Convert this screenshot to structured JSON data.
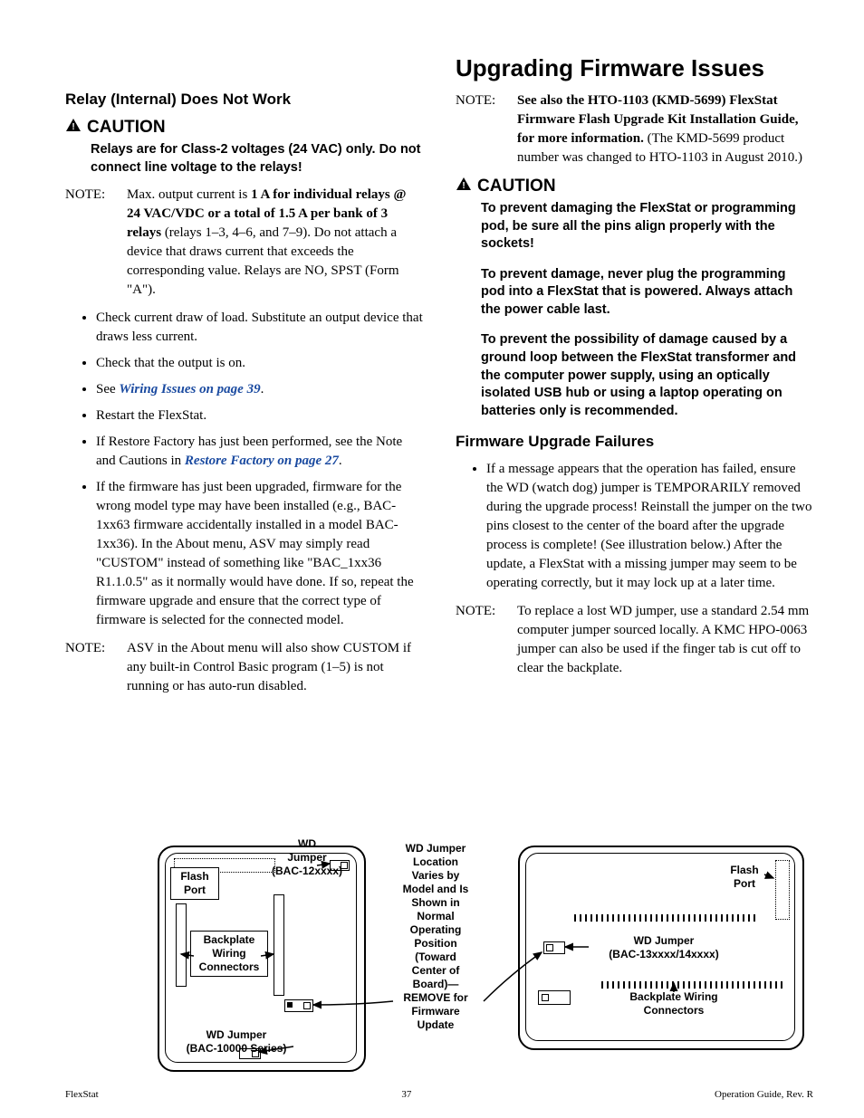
{
  "left": {
    "heading_relay": "Relay (Internal) Does Not Work",
    "caution_label": "CAUTION",
    "caution_body": "Relays are for Class-2 voltages (24 VAC) only. Do not connect line voltage to the relays!",
    "note1_label": "NOTE:",
    "note1_pre": "Max. output current is ",
    "note1_bold": "1 A for individual relays @ 24 VAC/VDC or a total of 1.5 A per bank of 3 relays",
    "note1_post": " (relays 1–3, 4–6, and 7–9). Do not attach a device that draws current that exceeds the corresponding value. Relays are NO, SPST (Form \"A\").",
    "bullets": {
      "b1": "Check current draw of load. Substitute an output device that draws less current.",
      "b2": "Check that the output is on.",
      "b3_pre": "See ",
      "b3_link": "Wiring Issues on page 39",
      "b3_post": ".",
      "b4": "Restart the FlexStat.",
      "b5_pre": "If Restore Factory has just been performed, see the Note and Cautions in ",
      "b5_link": "Restore Factory on page 27",
      "b5_post": ".",
      "b6": "If the firmware has just been upgraded, firmware for the wrong model type may have been installed (e.g., BAC-1xx63 firmware accidentally installed in a model BAC-1xx36). In the About menu, ASV may simply read \"CUSTOM\" instead of something like \"BAC_1xx36 R1.1.0.5\" as it normally would have done. If so, repeat the firmware upgrade and ensure that the correct type of firmware is selected for the connected model."
    },
    "note2_label": "NOTE:",
    "note2_body": "ASV in the About menu will also show CUSTOM if any built-in Control Basic program (1–5) is not running or has auto-run disabled."
  },
  "right": {
    "heading_firmware": "Upgrading Firmware Issues",
    "note1_label": "NOTE:",
    "note1_bold": "See also the HTO-1103 (KMD-5699) FlexStat Firmware Flash Upgrade Kit Installation Guide, for more information.",
    "note1_rest": " (The KMD-5699 product number was changed to HTO-1103 in August 2010.)",
    "caution_label": "CAUTION",
    "caution_p1": "To prevent damaging the FlexStat or programming pod, be sure all the pins align properly with the sockets!",
    "caution_p2": "To prevent damage, never plug the programming pod into a FlexStat that is powered. Always attach the power cable last.",
    "caution_p3": "To prevent the possibility of damage caused by a ground loop between the FlexStat transformer and the computer power supply, using an optically isolated USB hub or using a laptop operating on batteries only is recommended.",
    "heading_failures": "Firmware Upgrade Failures",
    "fail_b1_pre": "If a message appears that the operation has failed, ",
    "fail_b1_bold": "ensure the WD (watch dog) jumper is TEMPORARILY removed during the upgrade process! Reinstall the jumper on the two pins closest to the center of the board after the upgrade process is complete!",
    "fail_b1_post": " (See illustration below.) After the update, a FlexStat with a missing jumper may seem to be operating correctly, but it may lock up at a later time.",
    "note2_label": "NOTE:",
    "note2_body": "To replace a lost WD jumper, use a standard 2.54 mm computer jumper sourced locally. A KMC HPO-0063 jumper can also be used if the finger tab is cut off to clear the backplate."
  },
  "figure": {
    "a_wd_jumper_12": "WD\nJumper\n(BAC-12xxxx)",
    "a_flash_port_left": "Flash\nPort",
    "a_backplate_left": "Backplate\nWiring\nConnectors",
    "a_wd_jumper_10000": "WD Jumper\n(BAC-10000 Series)",
    "a_center": "WD Jumper\nLocation\nVaries by\nModel and Is\nShown in\nNormal\nOperating\nPosition\n(Toward\nCenter of\nBoard)—\nREMOVE for\nFirmware\nUpdate",
    "a_flash_port_right": "Flash\nPort",
    "a_wd_jumper_13_14": "WD Jumper\n(BAC-13xxxx/14xxxx)",
    "a_backplate_right": "Backplate Wiring\nConnectors"
  },
  "footer": {
    "left": "FlexStat",
    "center": "37",
    "right": "Operation Guide, Rev. R"
  }
}
